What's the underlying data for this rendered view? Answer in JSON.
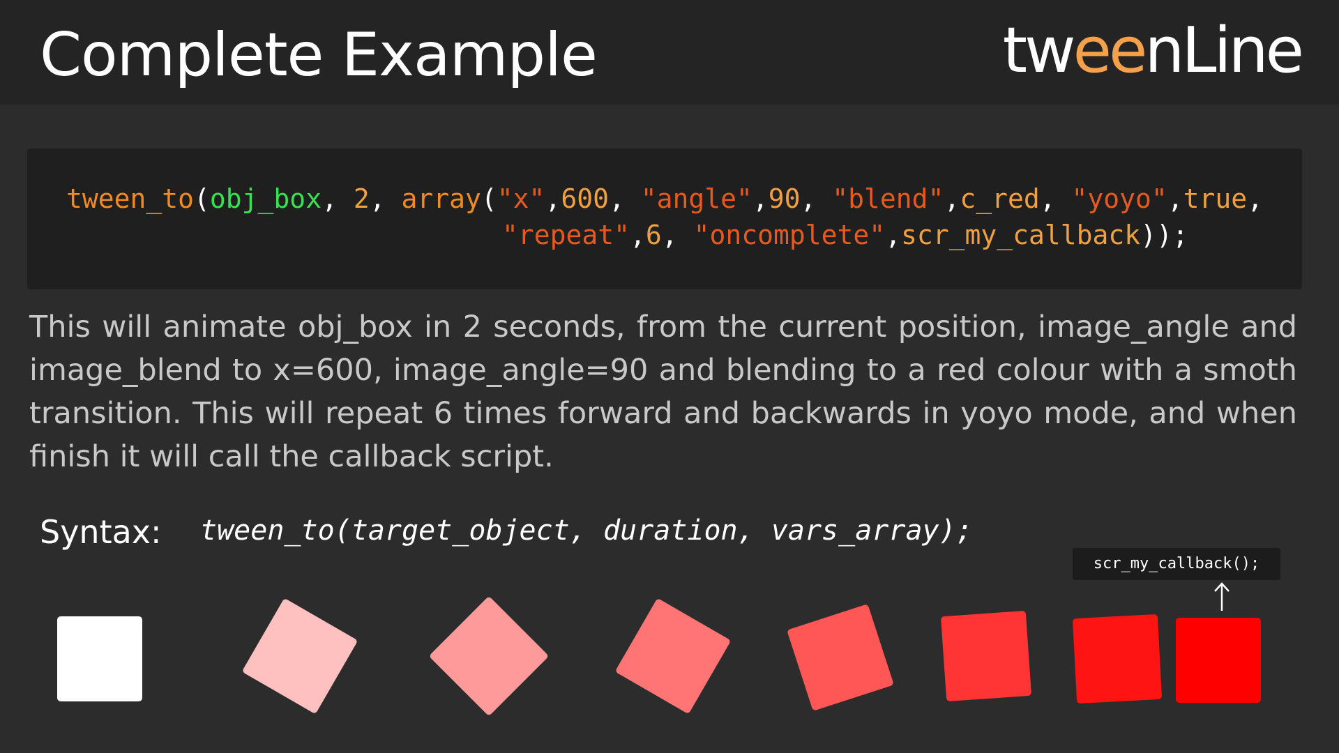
{
  "header": {
    "title": "Complete Example",
    "logo_part1": "tw",
    "logo_accent": "ee",
    "logo_part2": "nLine"
  },
  "code": {
    "line1": [
      {
        "t": "tween_to",
        "c": "fn"
      },
      {
        "t": "(",
        "c": "plain"
      },
      {
        "t": "obj_box",
        "c": "obj"
      },
      {
        "t": ", ",
        "c": "plain"
      },
      {
        "t": "2",
        "c": "num"
      },
      {
        "t": ", ",
        "c": "plain"
      },
      {
        "t": "array",
        "c": "fn"
      },
      {
        "t": "(",
        "c": "plain"
      },
      {
        "t": "\"x\"",
        "c": "str"
      },
      {
        "t": ",",
        "c": "plain"
      },
      {
        "t": "600",
        "c": "num"
      },
      {
        "t": ", ",
        "c": "plain"
      },
      {
        "t": "\"angle\"",
        "c": "str"
      },
      {
        "t": ",",
        "c": "plain"
      },
      {
        "t": "90",
        "c": "num"
      },
      {
        "t": ", ",
        "c": "plain"
      },
      {
        "t": "\"blend\"",
        "c": "str"
      },
      {
        "t": ",",
        "c": "plain"
      },
      {
        "t": "c_red",
        "c": "num"
      },
      {
        "t": ", ",
        "c": "plain"
      },
      {
        "t": "\"yoyo\"",
        "c": "str"
      },
      {
        "t": ",",
        "c": "plain"
      },
      {
        "t": "true",
        "c": "num"
      },
      {
        "t": ",",
        "c": "plain"
      }
    ],
    "line2": [
      {
        "t": "\"repeat\"",
        "c": "str"
      },
      {
        "t": ",",
        "c": "plain"
      },
      {
        "t": "6",
        "c": "num"
      },
      {
        "t": ", ",
        "c": "plain"
      },
      {
        "t": "\"oncomplete\"",
        "c": "str"
      },
      {
        "t": ",",
        "c": "plain"
      },
      {
        "t": "scr_my_callback",
        "c": "num"
      },
      {
        "t": "));",
        "c": "plain"
      }
    ]
  },
  "description": "This will animate obj_box in 2 seconds, from the current position, image_angle and image_blend to x=600, image_angle=90 and blending to a red colour with a smoth transition. This will repeat 6 times forward and backwards in yoyo mode, and when finish it will call the callback script.",
  "syntax": {
    "label": "Syntax:",
    "code": "tween_to(target_object, duration, vars_array);"
  },
  "callback_tip": "scr_my_callback();",
  "colors": {
    "header_bg": "#242424",
    "page_bg": "#2c2c2c",
    "code_bg": "#1f1f1f",
    "logo_accent": "#f5a04a",
    "fn": "#f08a24",
    "obj": "#39e052",
    "string": "#e65a1f"
  },
  "boxes": [
    {
      "color": "#ffffff",
      "angle": 0
    },
    {
      "color": "#ffc0c0",
      "angle": 30
    },
    {
      "color": "#ff9a9a",
      "angle": 45
    },
    {
      "color": "#ff7575",
      "angle": 30
    },
    {
      "color": "#ff5656",
      "angle": -18
    },
    {
      "color": "#ff3535",
      "angle": -4
    },
    {
      "color": "#ff1414",
      "angle": -3
    },
    {
      "color": "#ff0000",
      "angle": 0
    }
  ]
}
